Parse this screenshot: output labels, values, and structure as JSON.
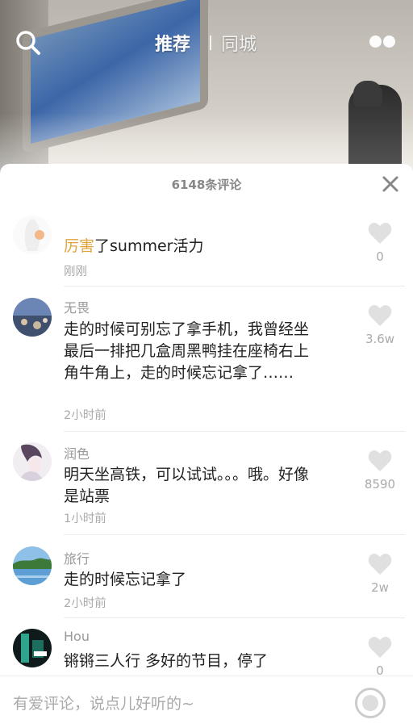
{
  "top_nav": {
    "tab_recommend": "推荐",
    "tab_local": "同城",
    "search_icon": "search-icon",
    "more_icon": "more-dots-icon"
  },
  "comments_panel": {
    "title": "6148条评论",
    "close_icon": "close-icon",
    "comments": [
      {
        "name": "",
        "text_highlight": "厉害",
        "text": "了summer活力",
        "time": "刚刚",
        "likes": "0"
      },
      {
        "name": "无畏",
        "text": "走的时候可别忘了拿手机，我曾经坐最后一排把几盒周黑鸭挂在座椅右上角牛角上，走的时候忘记拿了……",
        "time": "2小时前",
        "likes": "3.6w"
      },
      {
        "name": "润色",
        "text": "明天坐高铁，可以试试。。。哦。好像是站票",
        "time": "1小时前",
        "likes": "8590"
      },
      {
        "name": "旅行",
        "text": "走的时候忘记拿了",
        "time": "2小时前",
        "likes": "2w"
      },
      {
        "name": "Hou",
        "text": "锵锵三人行 多好的节目，停了",
        "time": "",
        "likes": "0"
      }
    ]
  },
  "comment_input": {
    "placeholder": "有爱评论，说点儿好听的~",
    "emoji_icon": "emoji-icon"
  },
  "colors": {
    "highlight": "#e2a33c",
    "secondary_text": "#999999",
    "primary_text": "#222222"
  }
}
